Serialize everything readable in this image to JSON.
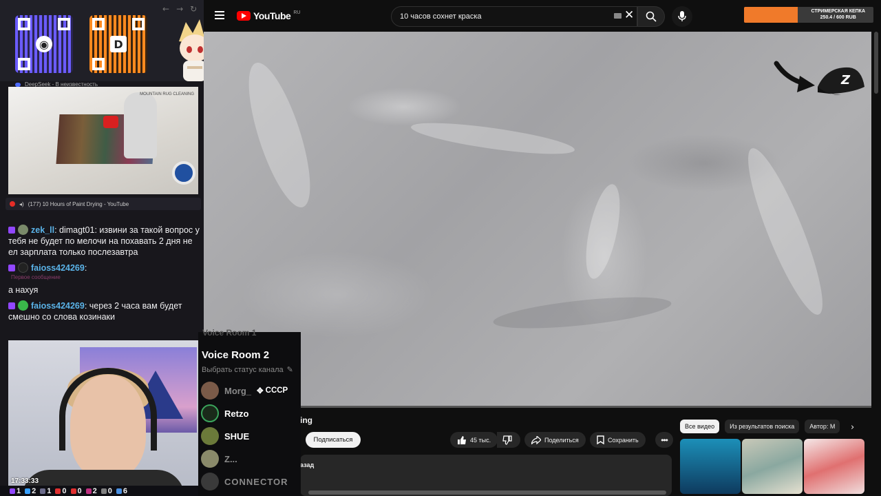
{
  "stream_overlay": {
    "mini_player_title": "DeepSeek - В неизвестность",
    "mini_player_caption": "(177) 10 Hours of Paint Drying - YouTube",
    "mini_player_logo": "MOUNTAIN RUG CLEANING",
    "chat": [
      {
        "user": "zek_ll",
        "text": "dimagt01: извини за такой вопрос у тебя не будет по мелочи на похавать 2 дня не ел зарплата только послезавтра",
        "first_message": false
      },
      {
        "user": "faioss424269",
        "text": "а нахуя",
        "first_message": true,
        "first_message_label": "Первое сообщение"
      },
      {
        "user": "faioss424269",
        "text": "через 2 часа вам будет смешно со слова козинаки",
        "first_message": false
      }
    ],
    "clock": "17:33:33",
    "stats": [
      {
        "icon": "viewers-icon",
        "value": "1",
        "color": "#9147ff"
      },
      {
        "icon": "users-icon",
        "value": "2",
        "color": "#38a0ff"
      },
      {
        "icon": "game-icon",
        "value": "1",
        "color": "#6b6b8a"
      },
      {
        "icon": "chat-icon",
        "value": "0",
        "color": "#e03030"
      },
      {
        "icon": "raid-icon",
        "value": "0",
        "color": "#e03030"
      },
      {
        "icon": "host-icon",
        "value": "2",
        "color": "#c03080"
      },
      {
        "icon": "warn-icon",
        "value": "0",
        "color": "#808080"
      },
      {
        "icon": "follow-icon",
        "value": "6",
        "color": "#4a90e2"
      }
    ]
  },
  "youtube": {
    "logo_text": "YouTube",
    "region": "RU",
    "search_query": "10 часов сохнет краска",
    "title_fragment": "ing",
    "subscribe_label": "Подписаться",
    "likes": "45 тыс.",
    "share_label": "Поделиться",
    "save_label": "Сохранить",
    "description_fragment": "азад",
    "chips": [
      "Все видео",
      "Из результатов поиска",
      "Автор: М"
    ]
  },
  "donation_goal": {
    "title": "СТРИМЕРСКАЯ КЕПКА",
    "progress_text": "250.4 / 600 RUB",
    "progress": 0.417,
    "accent": "#f07a2a"
  },
  "voice_overlay": {
    "ghost_title": "Voice Room 1",
    "room": "Voice Room 2",
    "status": "Выбрать статус канала",
    "members": [
      {
        "name": "Morg_",
        "tag": "CCCP",
        "dim": true,
        "color": "#7a5a48"
      },
      {
        "name": "Retzo",
        "dim": false,
        "color": "#1a2a1a"
      },
      {
        "name": "SHUE",
        "dim": false,
        "color": "#6b7a3a"
      },
      {
        "name": "Z...",
        "dim": true,
        "color": "#8a8a6a"
      },
      {
        "name": "CONNECTOR",
        "dim": true,
        "color": "#3a3a3a"
      }
    ]
  }
}
